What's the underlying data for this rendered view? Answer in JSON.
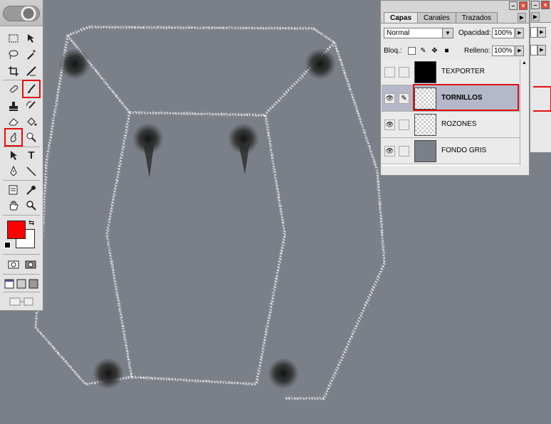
{
  "canvas": {
    "background": "#7b8088",
    "stroke_color": "#ffffff",
    "screw_color": "#1e1e1e"
  },
  "toolbox": {
    "foreground_color": "#ff0000",
    "background_color": "#ffffff",
    "highlight_color": "#e01010",
    "tools": [
      {
        "id": "marquee",
        "icon": "rect-marquee-icon"
      },
      {
        "id": "move",
        "icon": "move-icon"
      },
      {
        "id": "lasso",
        "icon": "lasso-icon"
      },
      {
        "id": "magic-wand",
        "icon": "magic-wand-icon"
      },
      {
        "id": "crop",
        "icon": "crop-icon"
      },
      {
        "id": "slice",
        "icon": "slice-icon"
      },
      {
        "id": "healing",
        "icon": "healing-brush-icon"
      },
      {
        "id": "brush",
        "icon": "brush-icon",
        "highlighted": true
      },
      {
        "id": "stamp",
        "icon": "clone-stamp-icon"
      },
      {
        "id": "history-brush",
        "icon": "history-brush-icon"
      },
      {
        "id": "eraser",
        "icon": "eraser-icon"
      },
      {
        "id": "bucket",
        "icon": "paint-bucket-icon"
      },
      {
        "id": "smudge",
        "icon": "smudge-icon",
        "highlighted": true
      },
      {
        "id": "dodge",
        "icon": "dodge-icon"
      },
      {
        "id": "path-select",
        "icon": "path-selection-icon"
      },
      {
        "id": "type",
        "icon": "type-icon",
        "label": "T"
      },
      {
        "id": "pen",
        "icon": "pen-icon"
      },
      {
        "id": "line",
        "icon": "line-icon"
      },
      {
        "id": "notes",
        "icon": "notes-icon"
      },
      {
        "id": "eyedropper",
        "icon": "eyedropper-icon"
      },
      {
        "id": "hand",
        "icon": "hand-icon"
      },
      {
        "id": "zoom",
        "icon": "zoom-icon"
      }
    ]
  },
  "layers_palette": {
    "tabs": [
      {
        "label": "Capas",
        "active": true
      },
      {
        "label": "Canales",
        "active": false
      },
      {
        "label": "Trazados",
        "active": false
      }
    ],
    "blend_mode": "Normal",
    "opacity_label": "Opacidad:",
    "opacity_value": "100%",
    "lock_label": "Bloq.:",
    "fill_label": "Relleno:",
    "fill_value": "100%",
    "layers": [
      {
        "name": "TEXPORTER",
        "visible": false,
        "selected": false,
        "thumb": "black"
      },
      {
        "name": "TORNILLOS",
        "visible": true,
        "selected": true,
        "thumb": "transparent"
      },
      {
        "name": "ROZONES",
        "visible": true,
        "selected": false,
        "thumb": "transparent"
      },
      {
        "name": "FONDO GRIS",
        "visible": true,
        "selected": false,
        "thumb": "gray"
      }
    ]
  }
}
